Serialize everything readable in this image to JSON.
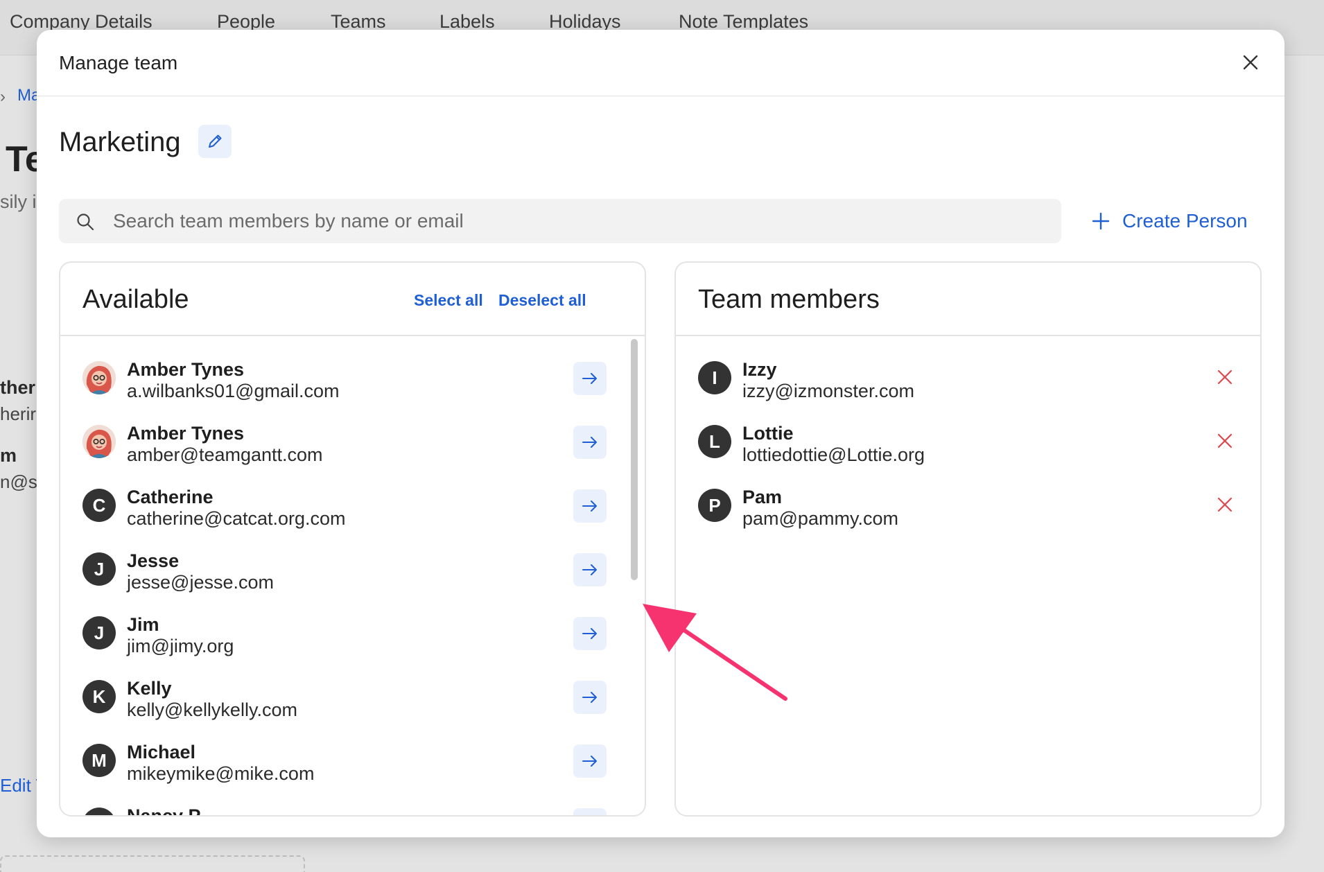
{
  "background": {
    "tabs": [
      "Company Details",
      "People",
      "Teams",
      "Labels",
      "Holidays",
      "Note Templates"
    ],
    "breadcrumb_fragment": "Ma",
    "heading_fragment": "Te",
    "subtitle_fragment": "sily i",
    "member_fragments": [
      {
        "name": "ther",
        "email": "herir"
      },
      {
        "name": "m",
        "email": "n@sa"
      }
    ],
    "edit_fragment": "Edit T"
  },
  "modal": {
    "title": "Manage team",
    "team_name": "Marketing",
    "search": {
      "placeholder": "Search team members by name or email",
      "value": ""
    },
    "create_label": "Create Person",
    "available": {
      "title": "Available",
      "select_all": "Select all",
      "deselect_all": "Deselect all",
      "people": [
        {
          "name": "Amber Tynes",
          "email": "a.wilbanks01@gmail.com",
          "avatar": "photo",
          "initial": ""
        },
        {
          "name": "Amber Tynes",
          "email": "amber@teamgantt.com",
          "avatar": "photo",
          "initial": ""
        },
        {
          "name": "Catherine",
          "email": "catherine@catcat.org.com",
          "avatar": "initial",
          "initial": "C"
        },
        {
          "name": "Jesse",
          "email": "jesse@jesse.com",
          "avatar": "initial",
          "initial": "J"
        },
        {
          "name": "Jim",
          "email": "jim@jimy.org",
          "avatar": "initial",
          "initial": "J"
        },
        {
          "name": "Kelly",
          "email": "kelly@kellykelly.com",
          "avatar": "initial",
          "initial": "K"
        },
        {
          "name": "Michael",
          "email": "mikeymike@mike.com",
          "avatar": "initial",
          "initial": "M"
        },
        {
          "name": "Nancy P",
          "email": "",
          "avatar": "initial",
          "initial": "N"
        }
      ]
    },
    "members": {
      "title": "Team members",
      "people": [
        {
          "name": "Izzy",
          "email": "izzy@izmonster.com",
          "initial": "I"
        },
        {
          "name": "Lottie",
          "email": "lottiedottie@Lottie.org",
          "initial": "L"
        },
        {
          "name": "Pam",
          "email": "pam@pammy.com",
          "initial": "P"
        }
      ]
    }
  },
  "colors": {
    "accent": "#1f5fd6",
    "remove": "#e0474c",
    "annotation": "#f6336f"
  },
  "icons": [
    "close-icon",
    "pencil-icon",
    "search-icon",
    "plus-icon",
    "arrow-right-icon",
    "x-icon",
    "annotation-arrow-icon"
  ]
}
